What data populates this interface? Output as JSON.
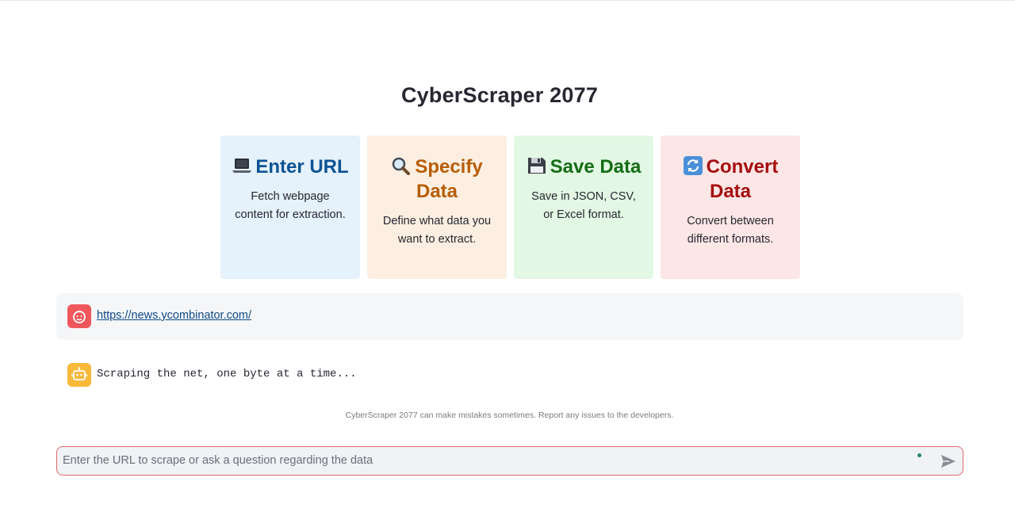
{
  "app": {
    "title": "CyberScraper 2077"
  },
  "cards": [
    {
      "icon": "laptop-icon",
      "title": "Enter URL",
      "description": "Fetch webpage content for extraction.",
      "color": "#0b5394",
      "background": "#e5f1fb"
    },
    {
      "icon": "magnifier-icon",
      "title": "Specify Data",
      "description": "Define what data you want to extract.",
      "color": "#b85c00",
      "background": "#fcefe2"
    },
    {
      "icon": "floppy-disk-icon",
      "title": "Save Data",
      "description": "Save in JSON, CSV, or Excel format.",
      "color": "#146c15",
      "background": "#e3f8e4"
    },
    {
      "icon": "refresh-icon",
      "title": "Convert Data",
      "description": "Convert between different formats.",
      "color": "#a50e0e",
      "background": "#fde6e6"
    }
  ],
  "chat": {
    "messages": [
      {
        "role": "user",
        "avatar": "user-face-icon",
        "text": "https://news.ycombinator.com/"
      },
      {
        "role": "assistant",
        "avatar": "robot-icon",
        "text": "Scraping the net, one byte at a time..."
      }
    ],
    "disclaimer": "CyberScraper 2077 can make mistakes sometimes. Report any issues to the developers.",
    "input": {
      "value": "",
      "placeholder": "Enter the URL to scrape or ask a question regarding the data"
    },
    "send_icon": "send-icon"
  },
  "colors": {
    "user_avatar": "#f0575c",
    "bot_avatar": "#f9b93b",
    "input_border": "#e06868",
    "link": "#0e4a86"
  }
}
